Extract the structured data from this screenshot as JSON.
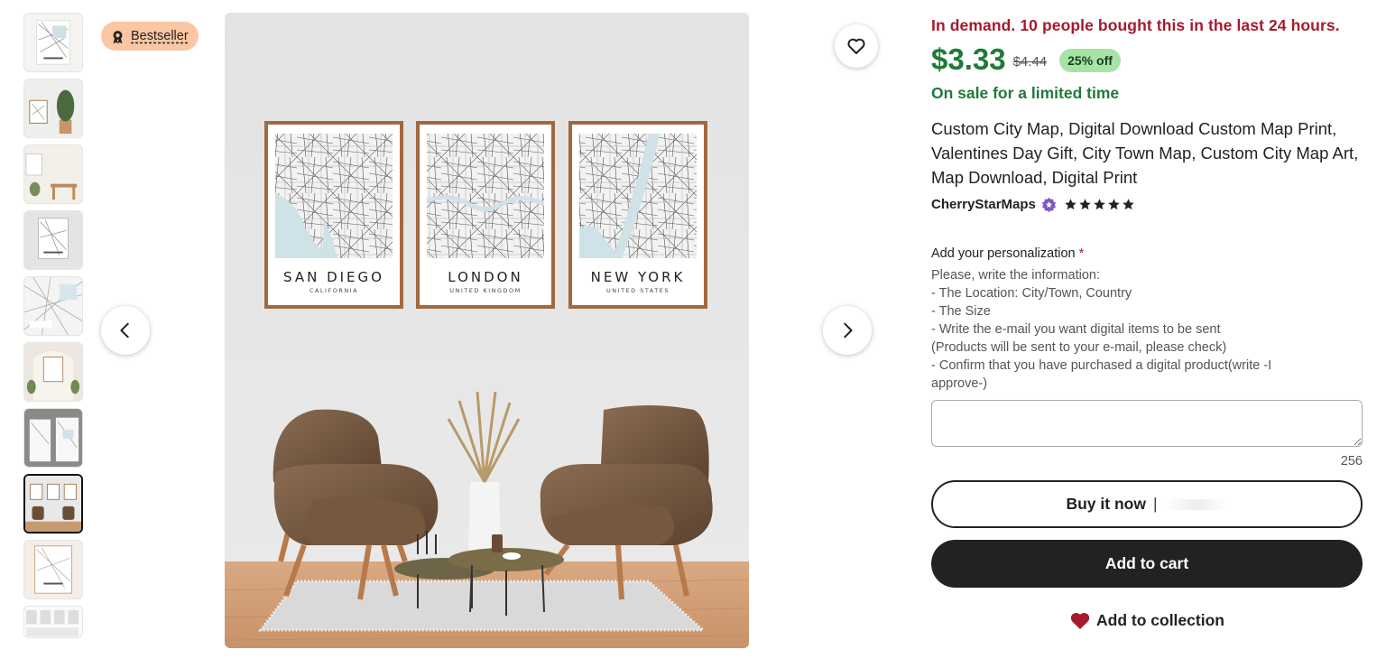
{
  "badge": {
    "label": "Bestseller",
    "icon": "award-icon"
  },
  "gallery": {
    "thumbnail_count": 10,
    "active_index": 7,
    "frames": [
      {
        "name": "SAN DIEGO",
        "sub": "CALIFORNIA"
      },
      {
        "name": "LONDON",
        "sub": "UNITED KINGDOM"
      },
      {
        "name": "NEW YORK",
        "sub": "UNITED STATES"
      }
    ]
  },
  "listing": {
    "demand": "In demand. 10 people bought this in the last 24 hours.",
    "price": "$3.33",
    "original_price": "$4.44",
    "discount": "25% off",
    "sale_note": "On sale for a limited time",
    "title": "Custom City Map, Digital Download Custom Map Print, Valentines Day Gift, City Town Map, Custom City Map Art, Map Download, Digital Print",
    "shop_name": "CherryStarMaps",
    "rating_stars": 5
  },
  "personalization": {
    "label": "Add your personalization",
    "required_mark": "*",
    "instructions": [
      "Please, write the information:",
      "- The Location: City/Town, Country",
      "- The Size",
      "- Write the e-mail you want digital items to be sent",
      "(Products will be sent to your e-mail, please check)",
      "- Confirm that you have purchased a digital product(write -I",
      "approve-)"
    ],
    "counter": "256"
  },
  "actions": {
    "buy_now": "Buy it now",
    "buy_now_sep": "|",
    "add_to_cart": "Add to cart",
    "add_to_collection": "Add to collection"
  },
  "colors": {
    "demand": "#a61a2e",
    "price": "#1f7a3a",
    "badge_bg": "#fbc6a3",
    "discount_bg": "#a6e3a7"
  }
}
